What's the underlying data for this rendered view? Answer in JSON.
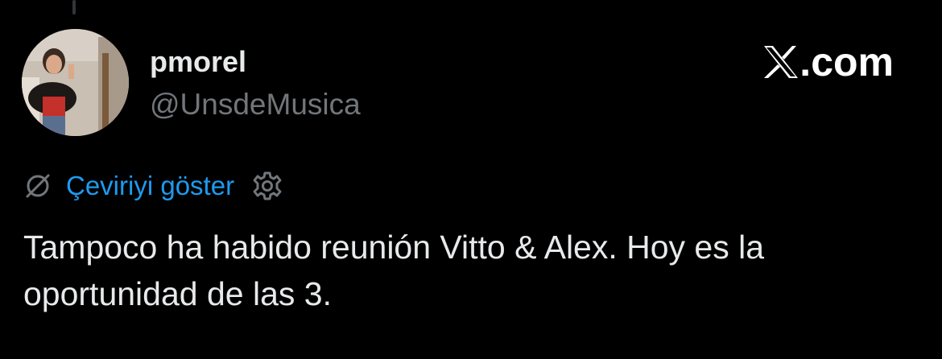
{
  "tweet": {
    "author": {
      "display_name": "pmorel",
      "handle": "@UnsdeMusica",
      "avatar_icon": "user-photo-avatar"
    },
    "brand": {
      "icon": "x-logo-icon",
      "text": ".com"
    },
    "translate": {
      "icon": "no-translation-icon",
      "label": "Çeviriyi göster",
      "settings_icon": "gear-icon"
    },
    "text": "Tampoco ha habido reunión Vitto & Alex. Hoy es la oportunidad de las 3."
  },
  "colors": {
    "background": "#000000",
    "primary_text": "#e7e9ea",
    "secondary_text": "#71767b",
    "link": "#1d9bf0"
  }
}
